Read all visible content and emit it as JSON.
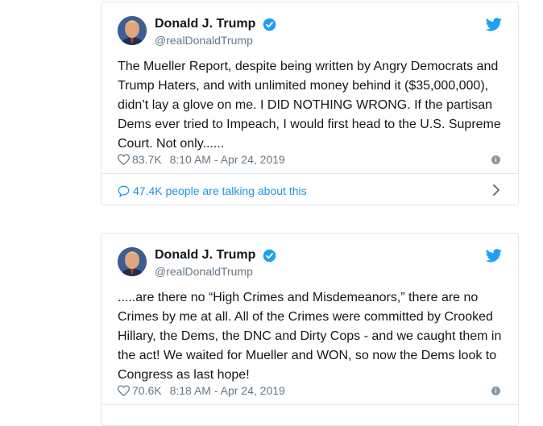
{
  "colors": {
    "accent": "#1da1f2",
    "link": "#1b95e0",
    "secondary_text": "#657786",
    "border": "#e1e8ed"
  },
  "tweets": [
    {
      "author_name": "Donald J. Trump",
      "handle": "@realDonaldTrump",
      "text": "The Mueller Report, despite being written by Angry Democrats and Trump Haters, and with unlimited money behind it ($35,000,000), didn’t lay a glove on me. I DID NOTHING WRONG. If the partisan Dems ever tried to Impeach, I would first head to the U.S. Supreme Court. Not only......",
      "likes": "83.7K",
      "timestamp": "8:10 AM - Apr 24, 2019",
      "talking": "47.4K people are talking about this",
      "icons": [
        "avatar",
        "verified-icon",
        "twitter-bird-icon",
        "heart-icon",
        "info-icon",
        "comment-bubble-icon",
        "chevron-right-icon"
      ]
    },
    {
      "author_name": "Donald J. Trump",
      "handle": "@realDonaldTrump",
      "text": ".....are there no “High Crimes and Misdemeanors,” there are no Crimes by me at all. All of the Crimes were committed by Crooked Hillary, the Dems, the DNC and Dirty Cops - and we caught them in the act! We waited for Mueller and WON, so now the Dems look to Congress as last hope!",
      "likes": "70.6K",
      "timestamp": "8:18 AM - Apr 24, 2019",
      "icons": [
        "avatar",
        "verified-icon",
        "twitter-bird-icon",
        "heart-icon",
        "info-icon"
      ]
    }
  ]
}
